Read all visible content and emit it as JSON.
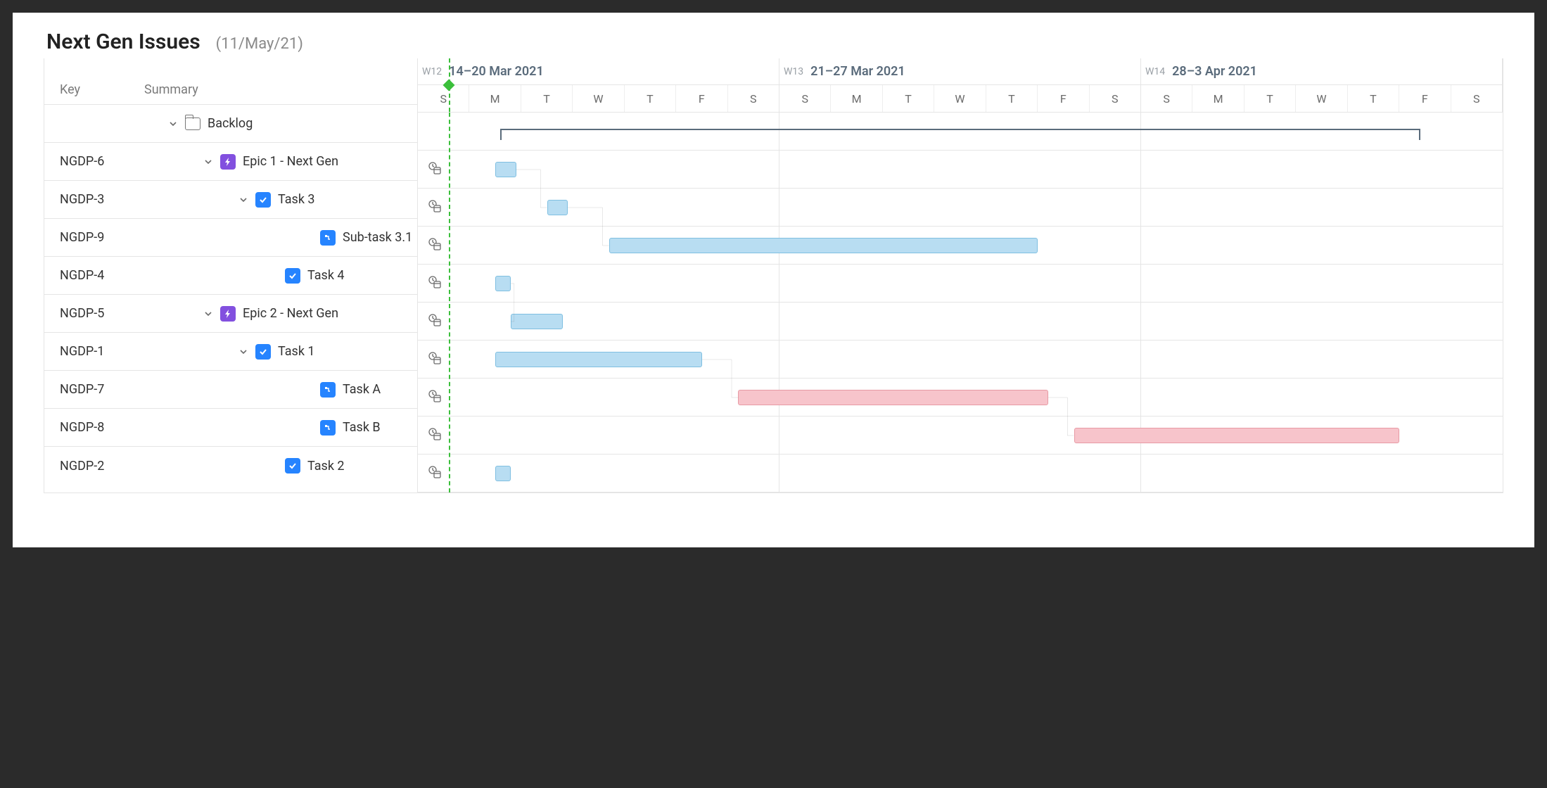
{
  "title": "Next Gen Issues",
  "subtitle": "(11/May/21)",
  "columns": {
    "key": "Key",
    "summary": "Summary"
  },
  "weeks": [
    {
      "num": "W12",
      "range": "14–20 Mar 2021",
      "days": [
        "S",
        "M",
        "T",
        "W",
        "T",
        "F",
        "S"
      ]
    },
    {
      "num": "W13",
      "range": "21–27 Mar 2021",
      "days": [
        "S",
        "M",
        "T",
        "W",
        "T",
        "F",
        "S"
      ]
    },
    {
      "num": "W14",
      "range": "28–3 Apr 2021",
      "days": [
        "S",
        "M",
        "T",
        "W",
        "T",
        "F",
        "S"
      ]
    }
  ],
  "rows": [
    {
      "key": "",
      "summary": "Backlog",
      "type": "folder",
      "indent": 0,
      "chev": true
    },
    {
      "key": "NGDP-6",
      "summary": "Epic 1 - Next Gen",
      "type": "epic",
      "indent": 1,
      "chev": true
    },
    {
      "key": "NGDP-3",
      "summary": "Task 3",
      "type": "task",
      "indent": 2,
      "chev": true
    },
    {
      "key": "NGDP-9",
      "summary": "Sub-task 3.1",
      "type": "subtask",
      "indent": 3,
      "chev": false
    },
    {
      "key": "NGDP-4",
      "summary": "Task 4",
      "type": "task",
      "indent": 2,
      "chev": false
    },
    {
      "key": "NGDP-5",
      "summary": "Epic 2 - Next Gen",
      "type": "epic",
      "indent": 1,
      "chev": true
    },
    {
      "key": "NGDP-1",
      "summary": "Task 1",
      "type": "task",
      "indent": 2,
      "chev": true
    },
    {
      "key": "NGDP-7",
      "summary": "Task A",
      "type": "subtask",
      "indent": 3,
      "chev": false
    },
    {
      "key": "NGDP-8",
      "summary": "Task B",
      "type": "subtask",
      "indent": 3,
      "chev": false
    },
    {
      "key": "NGDP-2",
      "summary": "Task 2",
      "type": "task",
      "indent": 2,
      "chev": false
    }
  ],
  "chart_data": {
    "type": "gantt",
    "time_axis": {
      "unit": "day",
      "start": "2021-03-14",
      "columns": 21,
      "today_marker_column": 0.6,
      "weeks": [
        {
          "label": "W12",
          "range": "14–20 Mar 2021"
        },
        {
          "label": "W13",
          "range": "21–27 Mar 2021"
        },
        {
          "label": "W14",
          "range": "28–3 Apr 2021"
        }
      ]
    },
    "summary_bracket": {
      "row": 0,
      "start_col": 1.6,
      "end_col": 19.4
    },
    "bars": [
      {
        "row": 1,
        "start_col": 1.5,
        "span": 0.4,
        "color": "blue"
      },
      {
        "row": 2,
        "start_col": 2.5,
        "span": 0.4,
        "color": "blue"
      },
      {
        "row": 3,
        "start_col": 3.7,
        "span": 8.3,
        "color": "blue"
      },
      {
        "row": 4,
        "start_col": 1.5,
        "span": 0.3,
        "color": "blue"
      },
      {
        "row": 5,
        "start_col": 1.8,
        "span": 1.0,
        "color": "blue"
      },
      {
        "row": 6,
        "start_col": 1.5,
        "span": 4.0,
        "color": "blue"
      },
      {
        "row": 7,
        "start_col": 6.2,
        "span": 6.0,
        "color": "pink"
      },
      {
        "row": 8,
        "start_col": 12.7,
        "span": 6.3,
        "color": "pink"
      },
      {
        "row": 9,
        "start_col": 1.5,
        "span": 0.3,
        "color": "blue"
      }
    ],
    "dependencies": [
      {
        "from_row": 1,
        "to_row": 2
      },
      {
        "from_row": 2,
        "to_row": 3
      },
      {
        "from_row": 4,
        "to_row": 5
      },
      {
        "from_row": 6,
        "to_row": 7
      },
      {
        "from_row": 7,
        "to_row": 8
      }
    ]
  }
}
